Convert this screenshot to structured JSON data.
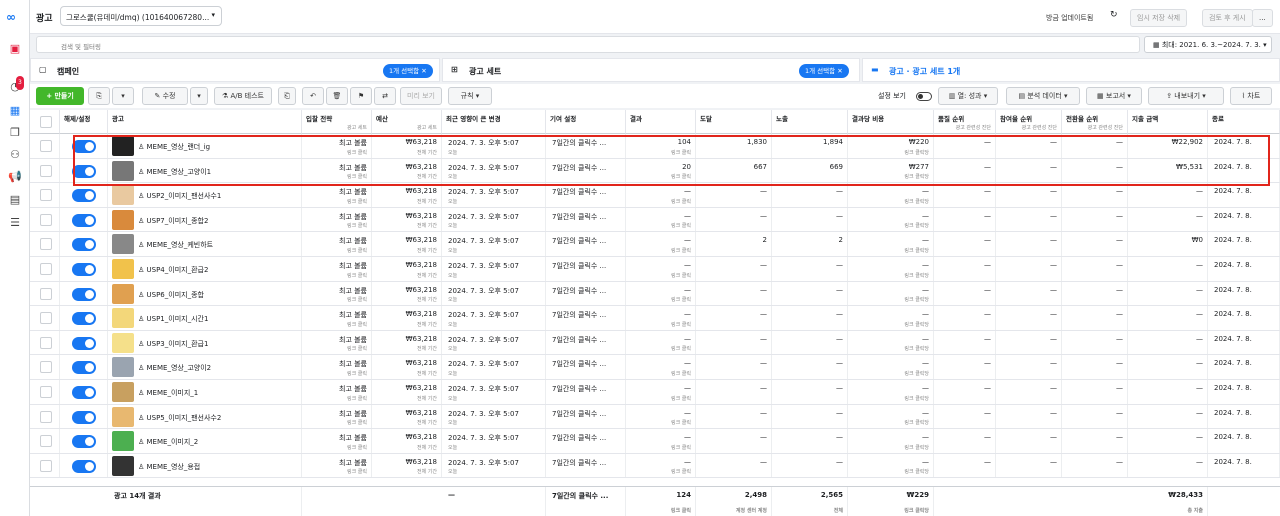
{
  "topbar": {
    "title": "광고",
    "account": "그로스쿨(유데미/dmq) (101640067280...",
    "updated": "방금 업데이트됨",
    "discard": "임시 저장 삭제",
    "review": "검토 후 게시",
    "more": "..."
  },
  "search": {
    "placeholder": "검색 및 필터링"
  },
  "date_range": "최대: 2021. 6. 3.~2024. 7. 3.",
  "panels": {
    "campaign": "캠페인",
    "campaign_chip": "1개 선택함",
    "adset": "광고 세트",
    "adset_chip": "1개 선택함",
    "ads": "광고 · 광고 세트 1개"
  },
  "toolbar": {
    "create": "+ 만들기",
    "edit": "수정",
    "ab": "A/B 테스트",
    "preview": "미리 보기",
    "rules": "규칙",
    "settings": "설정 보기",
    "columns": "열: 성과",
    "breakdown": "분석 데이터",
    "reports": "보고서",
    "export": "내보내기",
    "chart": "차트"
  },
  "columns": [
    {
      "label": "해제/설정",
      "sub": ""
    },
    {
      "label": "광고",
      "sub": ""
    },
    {
      "label": "입찰 전략",
      "sub": "광고 세트"
    },
    {
      "label": "예산",
      "sub": "광고 세트"
    },
    {
      "label": "최근 영향이 큰 변경",
      "sub": ""
    },
    {
      "label": "기여 설정",
      "sub": ""
    },
    {
      "label": "결과",
      "sub": ""
    },
    {
      "label": "도달",
      "sub": ""
    },
    {
      "label": "노출",
      "sub": ""
    },
    {
      "label": "결과당 비용",
      "sub": ""
    },
    {
      "label": "품질 순위",
      "sub": "광고 관련성 진단"
    },
    {
      "label": "참여율 순위",
      "sub": "광고 관련성 진단"
    },
    {
      "label": "전환율 순위",
      "sub": "광고 관련성 진단"
    },
    {
      "label": "지출 금액",
      "sub": ""
    },
    {
      "label": "종료",
      "sub": ""
    }
  ],
  "rows": [
    {
      "name": "MEME_영상_랜더_ig",
      "bid": "최고 볼륨",
      "bid_sub": "링크 클릭",
      "budget": "₩63,218",
      "budget_sub": "전체 기간",
      "change": "2024. 7. 3. 오후 5:07",
      "change_sub": "오늘",
      "attr": "7일간의 클릭수 ...",
      "result": "104",
      "result_sub": "링크 클릭",
      "reach": "1,830",
      "impr": "1,894",
      "cpr": "₩220",
      "cpr_sub": "링크 클릭당",
      "q": "—",
      "e": "—",
      "cv": "—",
      "spend": "₩22,902",
      "end": "2024. 7. 8.",
      "color": "#222"
    },
    {
      "name": "MEME_영상_고양이1",
      "bid": "최고 볼륨",
      "bid_sub": "링크 클릭",
      "budget": "₩63,218",
      "budget_sub": "전체 기간",
      "change": "2024. 7. 3. 오후 5:07",
      "change_sub": "오늘",
      "attr": "7일간의 클릭수 ...",
      "result": "20",
      "result_sub": "링크 클릭",
      "reach": "667",
      "impr": "669",
      "cpr": "₩277",
      "cpr_sub": "링크 클릭당",
      "q": "—",
      "e": "—",
      "cv": "—",
      "spend": "₩5,531",
      "end": "2024. 7. 8.",
      "color": "#777"
    },
    {
      "name": "USP2_이미지_팬선사수1",
      "bid": "최고 볼륨",
      "bid_sub": "링크 클릭",
      "budget": "₩63,218",
      "budget_sub": "전체 기간",
      "change": "2024. 7. 3. 오후 5:07",
      "change_sub": "오늘",
      "attr": "7일간의 클릭수 ...",
      "result": "—",
      "result_sub": "링크 클릭",
      "reach": "—",
      "impr": "—",
      "cpr": "—",
      "cpr_sub": "링크 클릭당",
      "q": "—",
      "e": "—",
      "cv": "—",
      "spend": "—",
      "end": "2024. 7. 8.",
      "color": "#e9c9a0"
    },
    {
      "name": "USP7_이미지_종합2",
      "bid": "최고 볼륨",
      "bid_sub": "링크 클릭",
      "budget": "₩63,218",
      "budget_sub": "전체 기간",
      "change": "2024. 7. 3. 오후 5:07",
      "change_sub": "오늘",
      "attr": "7일간의 클릭수 ...",
      "result": "—",
      "result_sub": "링크 클릭",
      "reach": "—",
      "impr": "—",
      "cpr": "—",
      "cpr_sub": "링크 클릭당",
      "q": "—",
      "e": "—",
      "cv": "—",
      "spend": "—",
      "end": "2024. 7. 8.",
      "color": "#d98a3c"
    },
    {
      "name": "MEME_영상_케빈하트",
      "bid": "최고 볼륨",
      "bid_sub": "링크 클릭",
      "budget": "₩63,218",
      "budget_sub": "전체 기간",
      "change": "2024. 7. 3. 오후 5:07",
      "change_sub": "오늘",
      "attr": "7일간의 클릭수 ...",
      "result": "—",
      "result_sub": "링크 클릭",
      "reach": "2",
      "impr": "2",
      "cpr": "—",
      "cpr_sub": "링크 클릭당",
      "q": "—",
      "e": "—",
      "cv": "—",
      "spend": "₩0",
      "end": "2024. 7. 8.",
      "color": "#888"
    },
    {
      "name": "USP4_이미지_환급2",
      "bid": "최고 볼륨",
      "bid_sub": "링크 클릭",
      "budget": "₩63,218",
      "budget_sub": "전체 기간",
      "change": "2024. 7. 3. 오후 5:07",
      "change_sub": "오늘",
      "attr": "7일간의 클릭수 ...",
      "result": "—",
      "result_sub": "링크 클릭",
      "reach": "—",
      "impr": "—",
      "cpr": "—",
      "cpr_sub": "링크 클릭당",
      "q": "—",
      "e": "—",
      "cv": "—",
      "spend": "—",
      "end": "2024. 7. 8.",
      "color": "#f1c24b"
    },
    {
      "name": "USP6_이미지_종합",
      "bid": "최고 볼륨",
      "bid_sub": "링크 클릭",
      "budget": "₩63,218",
      "budget_sub": "전체 기간",
      "change": "2024. 7. 3. 오후 5:07",
      "change_sub": "오늘",
      "attr": "7일간의 클릭수 ...",
      "result": "—",
      "result_sub": "링크 클릭",
      "reach": "—",
      "impr": "—",
      "cpr": "—",
      "cpr_sub": "링크 클릭당",
      "q": "—",
      "e": "—",
      "cv": "—",
      "spend": "—",
      "end": "2024. 7. 8.",
      "color": "#e0a050"
    },
    {
      "name": "USP1_이미지_시간1",
      "bid": "최고 볼륨",
      "bid_sub": "링크 클릭",
      "budget": "₩63,218",
      "budget_sub": "전체 기간",
      "change": "2024. 7. 3. 오후 5:07",
      "change_sub": "오늘",
      "attr": "7일간의 클릭수 ...",
      "result": "—",
      "result_sub": "링크 클릭",
      "reach": "—",
      "impr": "—",
      "cpr": "—",
      "cpr_sub": "링크 클릭당",
      "q": "—",
      "e": "—",
      "cv": "—",
      "spend": "—",
      "end": "2024. 7. 8.",
      "color": "#f3d77a"
    },
    {
      "name": "USP3_이미지_환급1",
      "bid": "최고 볼륨",
      "bid_sub": "링크 클릭",
      "budget": "₩63,218",
      "budget_sub": "전체 기간",
      "change": "2024. 7. 3. 오후 5:07",
      "change_sub": "오늘",
      "attr": "7일간의 클릭수 ...",
      "result": "—",
      "result_sub": "링크 클릭",
      "reach": "—",
      "impr": "—",
      "cpr": "—",
      "cpr_sub": "링크 클릭당",
      "q": "—",
      "e": "—",
      "cv": "—",
      "spend": "—",
      "end": "2024. 7. 8.",
      "color": "#f5e08a"
    },
    {
      "name": "MEME_영상_고양이2",
      "bid": "최고 볼륨",
      "bid_sub": "링크 클릭",
      "budget": "₩63,218",
      "budget_sub": "전체 기간",
      "change": "2024. 7. 3. 오후 5:07",
      "change_sub": "오늘",
      "attr": "7일간의 클릭수 ...",
      "result": "—",
      "result_sub": "링크 클릭",
      "reach": "—",
      "impr": "—",
      "cpr": "—",
      "cpr_sub": "링크 클릭당",
      "q": "—",
      "e": "—",
      "cv": "—",
      "spend": "—",
      "end": "2024. 7. 8.",
      "color": "#9aa4b0"
    },
    {
      "name": "MEME_이미지_1",
      "bid": "최고 볼륨",
      "bid_sub": "링크 클릭",
      "budget": "₩63,218",
      "budget_sub": "전체 기간",
      "change": "2024. 7. 3. 오후 5:07",
      "change_sub": "오늘",
      "attr": "7일간의 클릭수 ...",
      "result": "—",
      "result_sub": "링크 클릭",
      "reach": "—",
      "impr": "—",
      "cpr": "—",
      "cpr_sub": "링크 클릭당",
      "q": "—",
      "e": "—",
      "cv": "—",
      "spend": "—",
      "end": "2024. 7. 8.",
      "color": "#c8a060"
    },
    {
      "name": "USP5_이미지_팬선사수2",
      "bid": "최고 볼륨",
      "bid_sub": "링크 클릭",
      "budget": "₩63,218",
      "budget_sub": "전체 기간",
      "change": "2024. 7. 3. 오후 5:07",
      "change_sub": "오늘",
      "attr": "7일간의 클릭수 ...",
      "result": "—",
      "result_sub": "링크 클릭",
      "reach": "—",
      "impr": "—",
      "cpr": "—",
      "cpr_sub": "링크 클릭당",
      "q": "—",
      "e": "—",
      "cv": "—",
      "spend": "—",
      "end": "2024. 7. 8.",
      "color": "#e8b870"
    },
    {
      "name": "MEME_이미지_2",
      "bid": "최고 볼륨",
      "bid_sub": "링크 클릭",
      "budget": "₩63,218",
      "budget_sub": "전체 기간",
      "change": "2024. 7. 3. 오후 5:07",
      "change_sub": "오늘",
      "attr": "7일간의 클릭수 ...",
      "result": "—",
      "result_sub": "링크 클릭",
      "reach": "—",
      "impr": "—",
      "cpr": "—",
      "cpr_sub": "링크 클릭당",
      "q": "—",
      "e": "—",
      "cv": "—",
      "spend": "—",
      "end": "2024. 7. 8.",
      "color": "#4caf50"
    },
    {
      "name": "MEME_영상_용접",
      "bid": "최고 볼륨",
      "bid_sub": "링크 클릭",
      "budget": "₩63,218",
      "budget_sub": "전체 기간",
      "change": "2024. 7. 3. 오후 5:07",
      "change_sub": "오늘",
      "attr": "7일간의 클릭수 ...",
      "result": "—",
      "result_sub": "링크 클릭",
      "reach": "—",
      "impr": "—",
      "cpr": "—",
      "cpr_sub": "링크 클릭당",
      "q": "—",
      "e": "—",
      "cv": "—",
      "spend": "—",
      "end": "2024. 7. 8.",
      "color": "#333"
    }
  ],
  "total": {
    "label": "광고 14개 결과",
    "change": "—",
    "attr": "7일간의 클릭수 ...",
    "result": "124",
    "result_sub": "링크 클릭",
    "reach": "2,498",
    "reach_sub": "계정 센터 계정",
    "impr": "2,565",
    "impr_sub": "전체",
    "cpr": "₩229",
    "cpr_sub": "링크 클릭당",
    "spend": "₩28,433",
    "spend_sub": "총 지출"
  }
}
